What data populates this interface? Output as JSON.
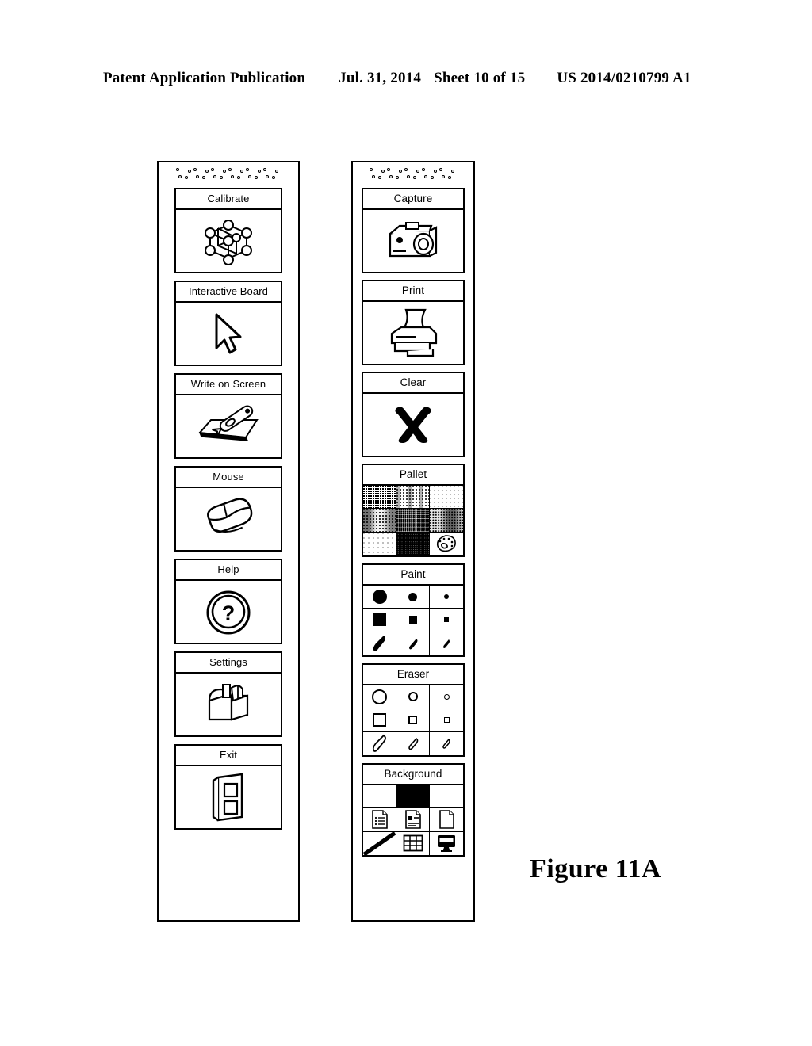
{
  "header": {
    "publication": "Patent Application Publication",
    "date": "Jul. 31, 2014",
    "sheet": "Sheet 10 of 15",
    "number": "US 2014/0210799 A1"
  },
  "figure": {
    "caption": "Figure 11A"
  },
  "toolbars": [
    {
      "id": "left",
      "name": "left-toolbar",
      "grille": "speaker-grille",
      "tiles": [
        {
          "label": "Calibrate",
          "icon": "calibration-lattice-icon",
          "type": "icon"
        },
        {
          "label": "Interactive Board",
          "icon": "cursor-arrow-icon",
          "type": "icon"
        },
        {
          "label": "Write on Screen",
          "icon": "stylus-on-paper-icon",
          "type": "icon"
        },
        {
          "label": "Mouse",
          "icon": "computer-mouse-icon",
          "type": "icon"
        },
        {
          "label": "Help",
          "icon": "question-mark-circle-icon",
          "type": "icon"
        },
        {
          "label": "Settings",
          "icon": "toolbox-icon",
          "type": "icon"
        },
        {
          "label": "Exit",
          "icon": "exit-door-icon",
          "type": "icon"
        }
      ]
    },
    {
      "id": "right",
      "name": "right-toolbar",
      "grille": "speaker-grille",
      "tiles": [
        {
          "label": "Capture",
          "icon": "camera-icon",
          "type": "icon"
        },
        {
          "label": "Print",
          "icon": "printer-icon",
          "type": "icon"
        },
        {
          "label": "Clear",
          "icon": "x-mark-icon",
          "type": "icon"
        },
        {
          "label": "Pallet",
          "type": "grid",
          "cells": [
            {
              "name": "pallet-swatch-1",
              "style": "s-dark"
            },
            {
              "name": "pallet-swatch-2",
              "style": "s-med"
            },
            {
              "name": "pallet-swatch-3",
              "style": "s-light"
            },
            {
              "name": "pallet-swatch-4",
              "style": "s-grad"
            },
            {
              "name": "pallet-swatch-5",
              "style": "s-dense"
            },
            {
              "name": "pallet-swatch-6",
              "style": "s-vgrad"
            },
            {
              "name": "pallet-swatch-7",
              "style": "s-vlight"
            },
            {
              "name": "pallet-swatch-8",
              "style": "s-black"
            },
            {
              "name": "pallet-more-colors",
              "style": "s-white",
              "icon": "artist-palette-icon"
            }
          ]
        },
        {
          "label": "Paint",
          "type": "grid",
          "cells": [
            {
              "name": "paint-circle-large",
              "icon": "filled-circle-large-icon"
            },
            {
              "name": "paint-circle-medium",
              "icon": "filled-circle-medium-icon"
            },
            {
              "name": "paint-circle-small",
              "icon": "filled-circle-small-icon"
            },
            {
              "name": "paint-square-large",
              "icon": "filled-square-large-icon"
            },
            {
              "name": "paint-square-medium",
              "icon": "filled-square-medium-icon"
            },
            {
              "name": "paint-square-small",
              "icon": "filled-square-small-icon"
            },
            {
              "name": "paint-stroke-large",
              "icon": "filled-stroke-large-icon"
            },
            {
              "name": "paint-stroke-medium",
              "icon": "filled-stroke-medium-icon"
            },
            {
              "name": "paint-stroke-small",
              "icon": "filled-stroke-small-icon"
            }
          ]
        },
        {
          "label": "Eraser",
          "type": "grid",
          "cells": [
            {
              "name": "eraser-circle-large",
              "icon": "outline-circle-large-icon"
            },
            {
              "name": "eraser-circle-medium",
              "icon": "outline-circle-medium-icon"
            },
            {
              "name": "eraser-circle-small",
              "icon": "outline-circle-small-icon"
            },
            {
              "name": "eraser-square-large",
              "icon": "outline-square-large-icon"
            },
            {
              "name": "eraser-square-medium",
              "icon": "outline-square-medium-icon"
            },
            {
              "name": "eraser-square-small",
              "icon": "outline-square-small-icon"
            },
            {
              "name": "eraser-stroke-large",
              "icon": "outline-stroke-large-icon"
            },
            {
              "name": "eraser-stroke-medium",
              "icon": "outline-stroke-medium-icon"
            },
            {
              "name": "eraser-stroke-small",
              "icon": "outline-stroke-small-icon"
            }
          ]
        },
        {
          "label": "Background",
          "type": "grid",
          "cells": [
            {
              "name": "background-white",
              "style": "s-white"
            },
            {
              "name": "background-black",
              "style": "s-solid-black"
            },
            {
              "name": "background-blank",
              "style": "s-white"
            },
            {
              "name": "background-lined-document",
              "icon": "lined-document-icon"
            },
            {
              "name": "background-bulleted-document",
              "icon": "bulleted-document-icon"
            },
            {
              "name": "background-plain-document",
              "icon": "plain-document-icon"
            },
            {
              "name": "background-diagonal-line",
              "icon": "diagonal-line-icon"
            },
            {
              "name": "background-grid",
              "icon": "grid-table-icon"
            },
            {
              "name": "background-desktop",
              "icon": "monitor-icon"
            }
          ]
        }
      ]
    }
  ]
}
